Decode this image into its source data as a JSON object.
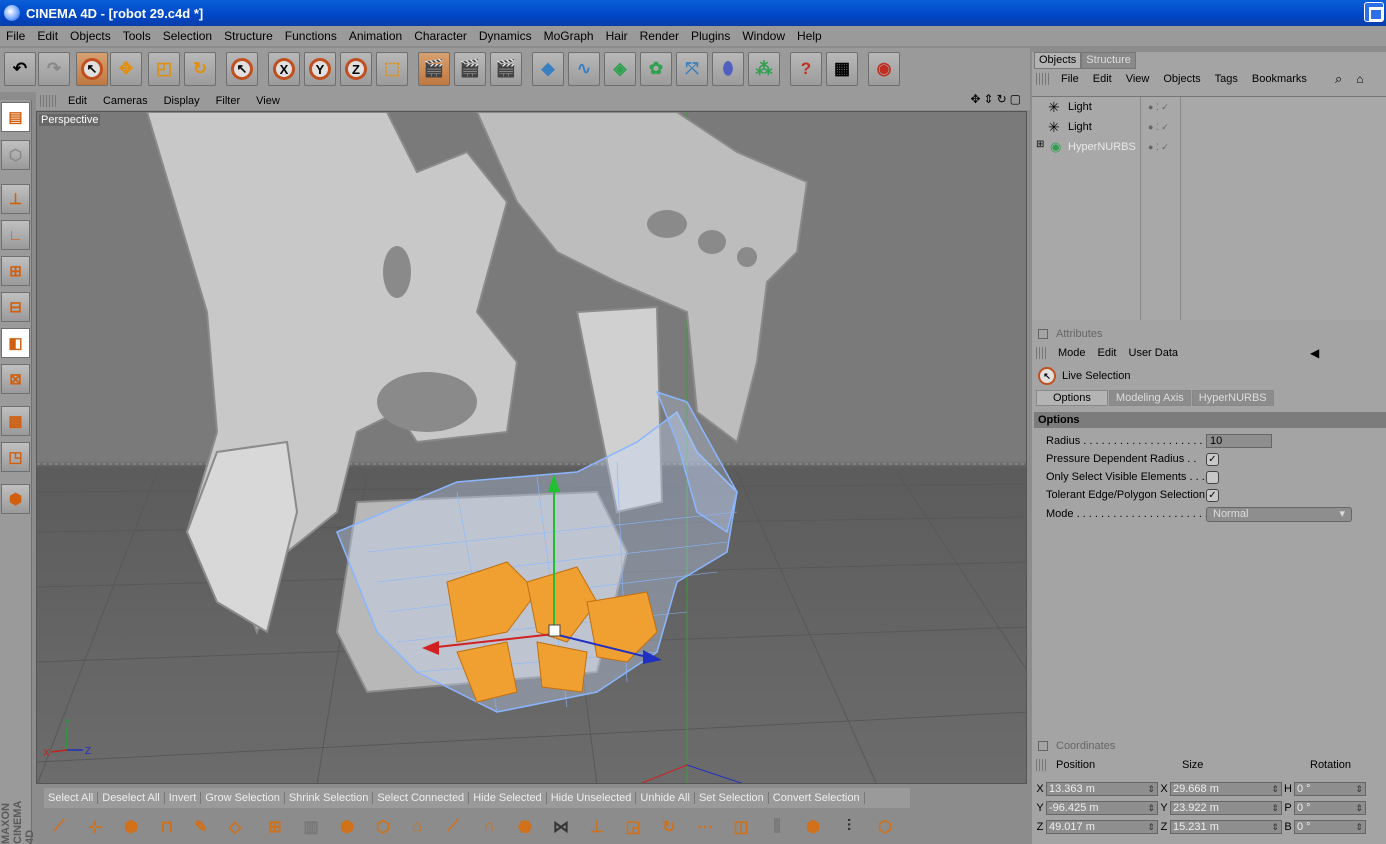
{
  "window": {
    "title": "CINEMA 4D - [robot 29.c4d *]"
  },
  "menu": [
    "File",
    "Edit",
    "Objects",
    "Tools",
    "Selection",
    "Structure",
    "Functions",
    "Animation",
    "Character",
    "Dynamics",
    "MoGraph",
    "Hair",
    "Render",
    "Plugins",
    "Window",
    "Help"
  ],
  "toolbar": {
    "axes": [
      "X",
      "Y",
      "Z"
    ]
  },
  "viewport": {
    "menu": [
      "Edit",
      "Cameras",
      "Display",
      "Filter",
      "View"
    ],
    "label": "Perspective",
    "axis_labels": {
      "x": "X",
      "y": "Y",
      "z": "Z"
    }
  },
  "object_manager": {
    "tabs": [
      "Objects",
      "Structure"
    ],
    "menu": [
      "File",
      "Edit",
      "View",
      "Objects",
      "Tags",
      "Bookmarks"
    ],
    "objects": [
      {
        "name": "Light"
      },
      {
        "name": "Light"
      },
      {
        "name": "HyperNURBS"
      }
    ]
  },
  "attributes": {
    "header": "Attributes",
    "menu": [
      "Mode",
      "Edit",
      "User Data"
    ],
    "tool_name": "Live Selection",
    "tabs": [
      "Options",
      "Modeling Axis",
      "HyperNURBS"
    ],
    "section": "Options",
    "fields": {
      "radius_label": "Radius . . . . . . . . . . . . . . . . . . . . . . .",
      "radius_value": "10",
      "pressure_label": "Pressure Dependent Radius . .",
      "pressure_checked": true,
      "visible_label": "Only Select Visible Elements . . .",
      "visible_checked": false,
      "tolerant_label": "Tolerant Edge/Polygon Selection",
      "tolerant_checked": true,
      "mode_label": "Mode . . . . . . . . . . . . . . . . . . . . . . . . .",
      "mode_value": "Normal"
    }
  },
  "coordinates": {
    "header": "Coordinates",
    "columns": [
      "Position",
      "Size",
      "Rotation"
    ],
    "rows": [
      {
        "p_axis": "X",
        "p": "13.363 m",
        "s_axis": "X",
        "s": "29.668 m",
        "r_axis": "H",
        "r": "0 °"
      },
      {
        "p_axis": "Y",
        "p": "-96.425 m",
        "s_axis": "Y",
        "s": "23.922 m",
        "r_axis": "P",
        "r": "0 °"
      },
      {
        "p_axis": "Z",
        "p": "49.017 m",
        "s_axis": "Z",
        "s": "15.231 m",
        "r_axis": "B",
        "r": "0 °"
      }
    ]
  },
  "selection_bar": [
    "Select All",
    "Deselect All",
    "Invert",
    "Grow Selection",
    "Shrink Selection",
    "Select Connected",
    "Hide Selected",
    "Hide Unselected",
    "Unhide All",
    "Set Selection",
    "Convert Selection"
  ],
  "brand": "MAXON CINEMA 4D",
  "colors": {
    "titlebar": "#0046c8",
    "accent_orange": "#d07018",
    "mesh_wire": "#7fb2ff",
    "selection": "#f0a030"
  }
}
